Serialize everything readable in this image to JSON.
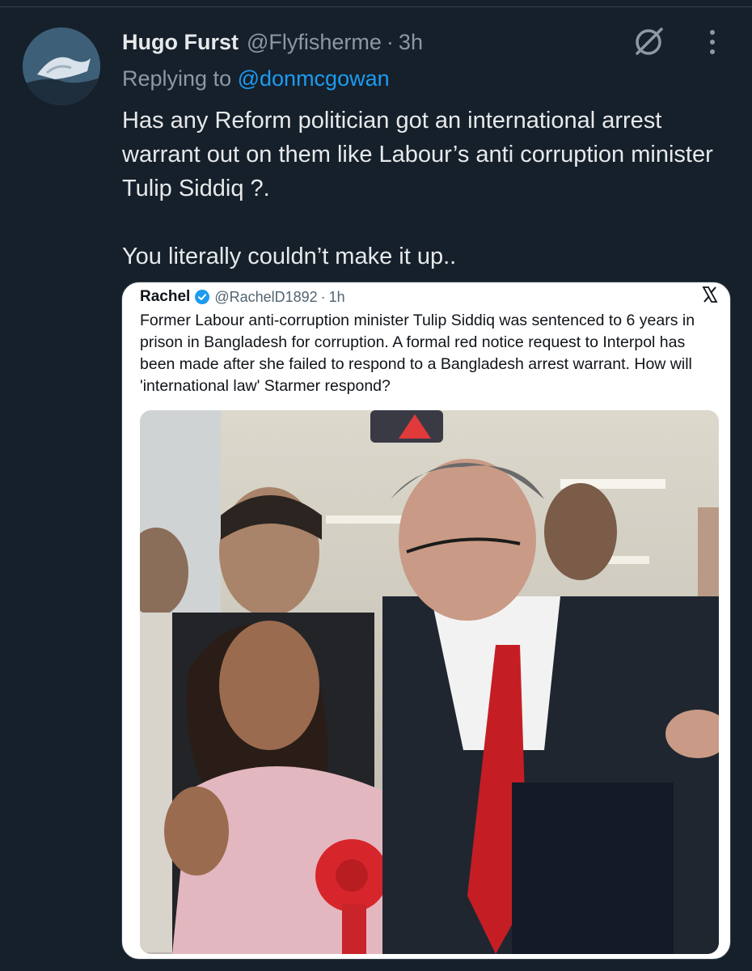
{
  "tweet": {
    "author_name": "Hugo Furst",
    "author_handle": "@Flyfisherme",
    "separator": "·",
    "time": "3h",
    "replying_label": "Replying to",
    "replying_to": "@donmcgowan",
    "text": "Has any Reform politician got an international arrest warrant out on them like Labour’s anti corruption minister Tulip Siddiq ?.\n\nYou literally couldn’t make it up.."
  },
  "quoted": {
    "author_name": "Rachel",
    "author_handle": "@RachelD1892",
    "separator": "·",
    "time": "1h",
    "text": "Former Labour anti-corruption minister Tulip Siddiq was sentenced to 6 years in prison in Bangladesh for corruption. A formal red notice request to Interpol has been made after she failed to respond to a Bangladesh arrest warrant. How will 'international law' Starmer respond?"
  },
  "icons": [
    "grok-icon",
    "more-options-icon",
    "verified-badge-icon",
    "x-logo-icon"
  ],
  "colors": {
    "background": "#15202b",
    "text_primary": "#e7e9ea",
    "text_secondary": "#8b98a5",
    "link": "#1d9bf0",
    "verified": "#1d9bf0"
  }
}
